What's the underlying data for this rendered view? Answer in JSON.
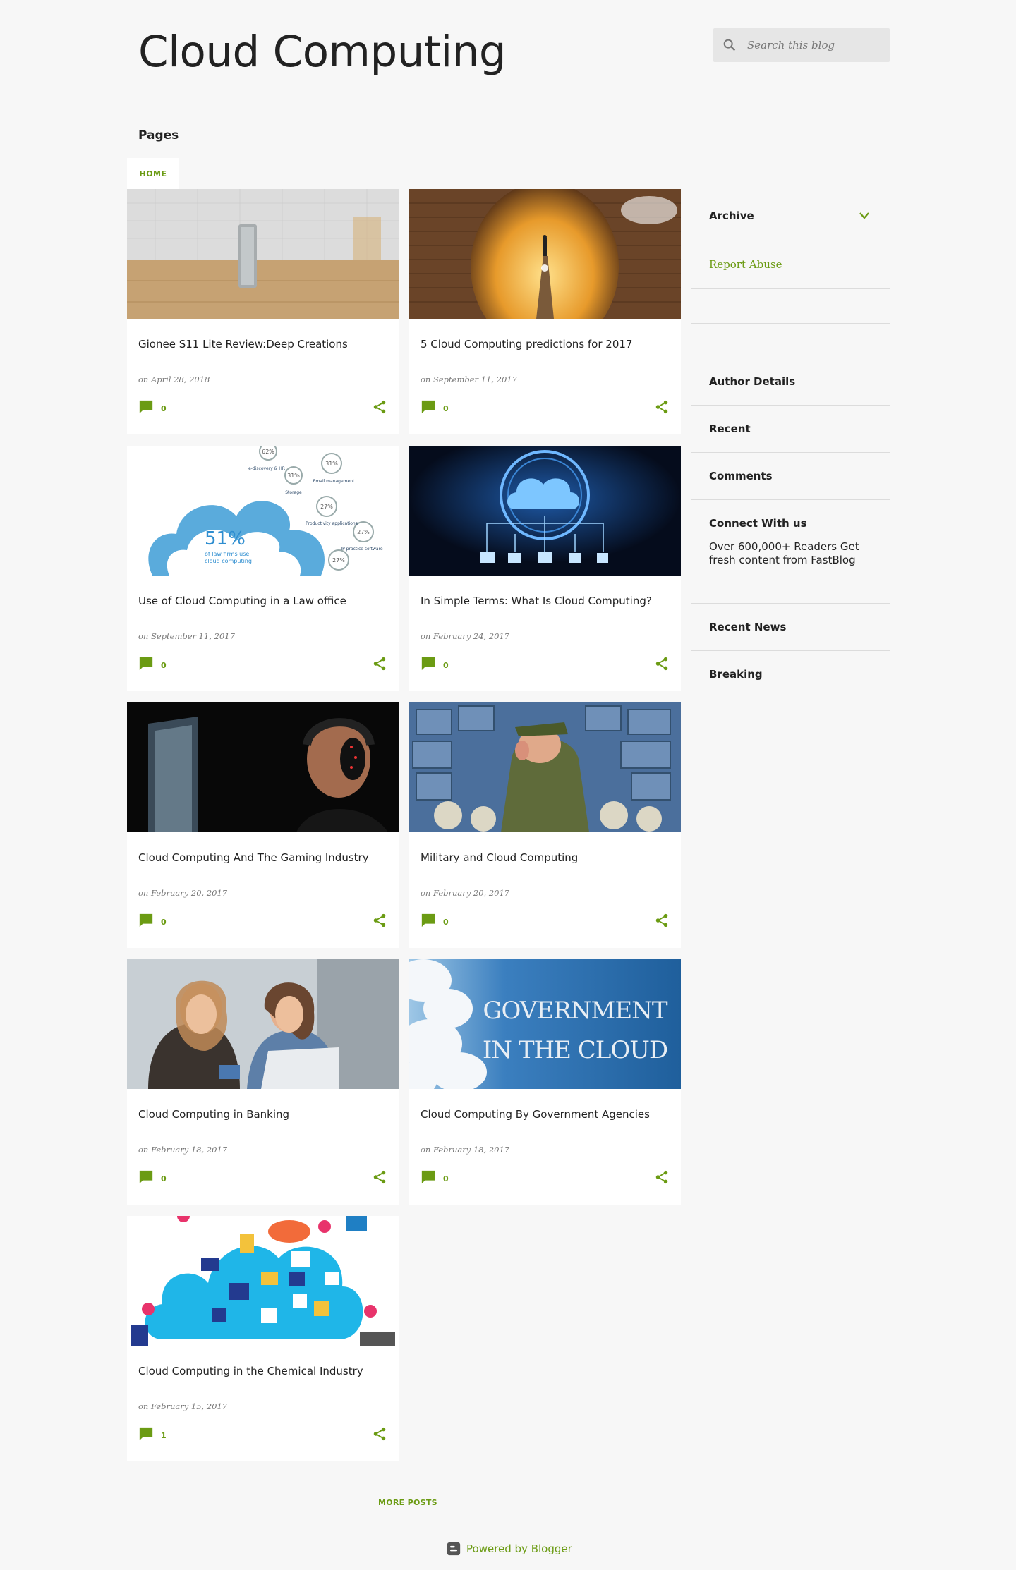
{
  "header": {
    "title": "Cloud Computing",
    "search_placeholder": "Search this blog"
  },
  "pages": {
    "heading": "Pages",
    "tabs": [
      {
        "label": "HOME"
      }
    ]
  },
  "posts": [
    {
      "title": "Gionee S11 Lite Review:Deep Creations",
      "date": "on April 28, 2018",
      "comments": "0",
      "image": "phone-on-table"
    },
    {
      "title": "5 Cloud Computing predictions for 2017",
      "date": "on September 11, 2017",
      "comments": "0",
      "image": "path-into-sky"
    },
    {
      "title": "Use of Cloud Computing in a Law office",
      "date": "on September 11, 2017",
      "comments": "0",
      "image": "law-firm-cloud-infographic"
    },
    {
      "title": "In Simple Terms: What Is Cloud Computing?",
      "date": "on February 24, 2017",
      "comments": "0",
      "image": "glowing-cloud-network"
    },
    {
      "title": "Cloud Computing And The Gaming Industry",
      "date": "on February 20, 2017",
      "comments": "0",
      "image": "gamer-headset"
    },
    {
      "title": "Military and Cloud Computing",
      "date": "on February 20, 2017",
      "comments": "0",
      "image": "military-cartoon"
    },
    {
      "title": "Cloud Computing in Banking",
      "date": "on February 18, 2017",
      "comments": "0",
      "image": "women-with-laptop"
    },
    {
      "title": "Cloud Computing By Government Agencies",
      "date": "on February 18, 2017",
      "comments": "0",
      "image": "government-cloud-banner"
    },
    {
      "title": "Cloud Computing in the Chemical Industry",
      "date": "on February 15, 2017",
      "comments": "1",
      "image": "cloud-apps-illustration"
    }
  ],
  "infographic": {
    "main_percent": "51%",
    "main_caption_1": "of law firms use",
    "main_caption_2": "cloud computing",
    "bubbles": [
      "62%",
      "31%",
      "31%",
      "27%",
      "27%",
      "27%"
    ],
    "labels": [
      "e-discovery & HR",
      "Storage",
      "Email management",
      "Productivity applications",
      "IP practice software"
    ]
  },
  "gov_banner": {
    "line1": "GOVERNMENT",
    "line2": "IN THE CLOUD"
  },
  "more_posts": "MORE POSTS",
  "footer": {
    "powered": "Powered by Blogger"
  },
  "sidebar": {
    "archive": "Archive",
    "report_abuse": "Report Abuse",
    "author_details": "Author Details",
    "recent": "Recent",
    "comments": "Comments",
    "connect": "Connect With us",
    "connect_text": "Over 600,000+ Readers Get fresh content from FastBlog",
    "recent_news": "Recent News",
    "breaking": "Breaking"
  },
  "colors": {
    "accent": "#6b9b13",
    "background": "#f7f7f7"
  }
}
